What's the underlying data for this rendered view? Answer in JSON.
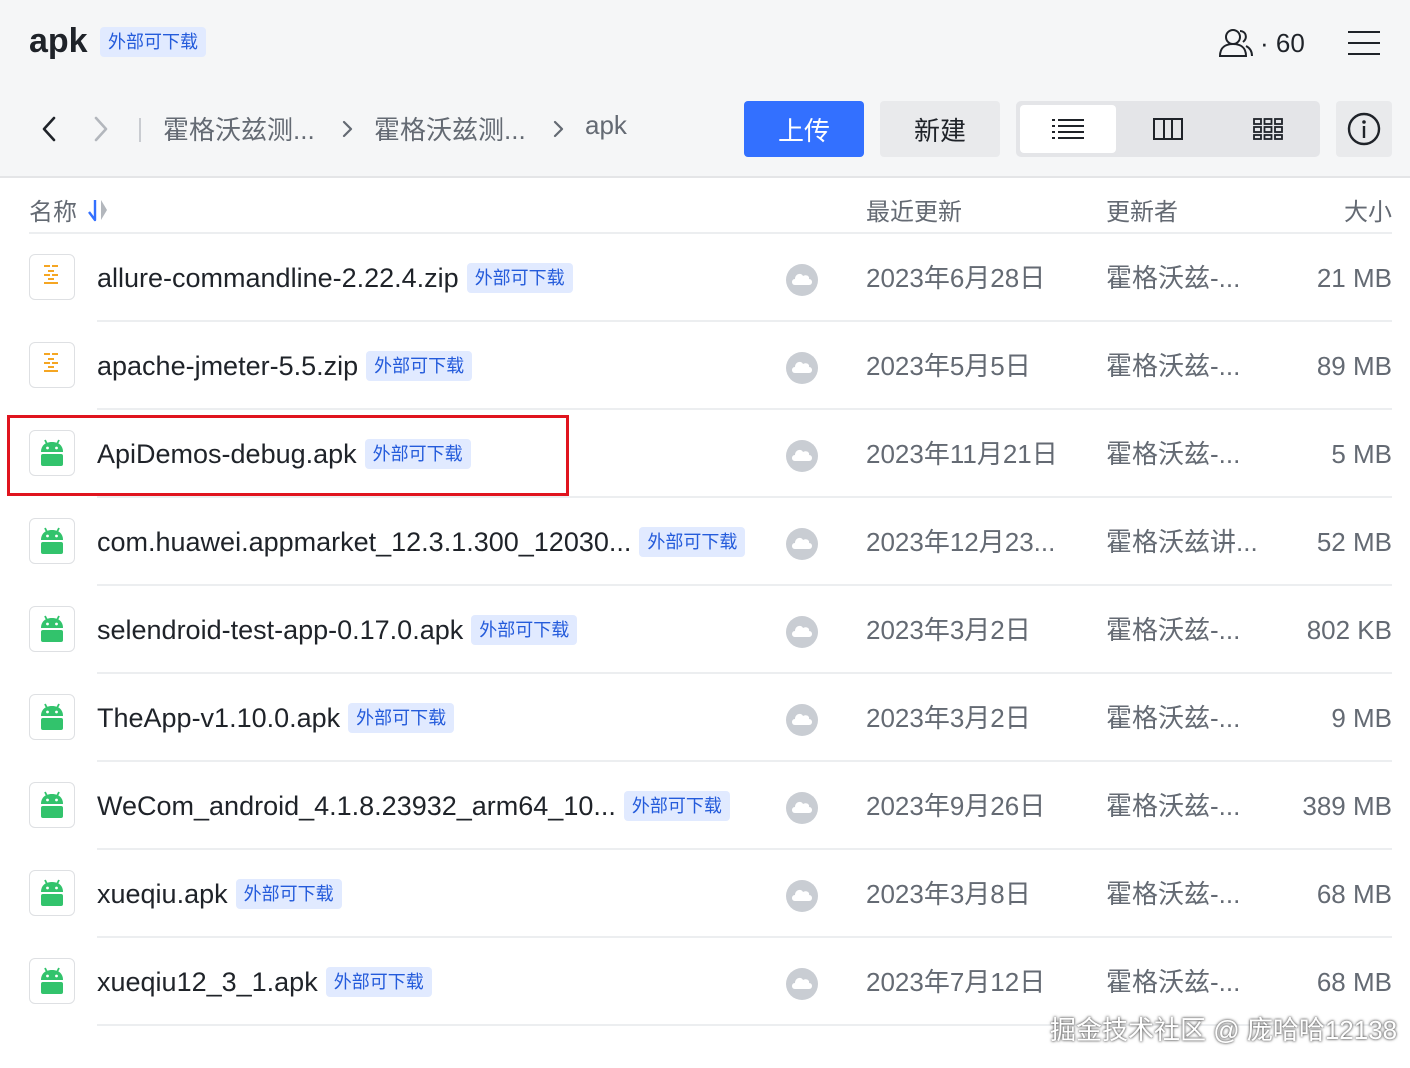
{
  "header": {
    "title": "apk",
    "title_badge": "外部可下载",
    "member_count": "· 60",
    "member_icon": "members-icon",
    "menu_icon": "hamburger-menu-icon"
  },
  "nav": {
    "back_icon": "chevron-left-icon",
    "forward_icon": "chevron-right-icon",
    "breadcrumbs": [
      "霍格沃兹测...",
      "霍格沃兹测...",
      "apk"
    ]
  },
  "toolbar": {
    "upload_label": "上传",
    "new_label": "新建",
    "views": [
      "list-view-icon",
      "column-view-icon",
      "grid-view-icon"
    ],
    "active_view": "list",
    "info_icon": "info-icon"
  },
  "columns": {
    "name": "名称",
    "updated": "最近更新",
    "updater": "更新者",
    "size": "大小",
    "sort_icon": "sort-icon"
  },
  "badge_text": "外部可下载",
  "files": [
    {
      "name": "allure-commandline-2.22.4.zip",
      "type": "zip",
      "badge": "外部可下载",
      "updated": "2023年6月28日",
      "updater": "霍格沃兹-...",
      "size": "21 MB"
    },
    {
      "name": "apache-jmeter-5.5.zip",
      "type": "zip",
      "badge": "外部可下载",
      "updated": "2023年5月5日",
      "updater": "霍格沃兹-...",
      "size": "89 MB"
    },
    {
      "name": "ApiDemos-debug.apk",
      "type": "apk",
      "badge": "外部可下载",
      "updated": "2023年11月21日",
      "updater": "霍格沃兹-...",
      "size": "5 MB"
    },
    {
      "name": "com.huawei.appmarket_12.3.1.300_12030...",
      "type": "apk",
      "badge": "外部可下载",
      "updated": "2023年12月23...",
      "updater": "霍格沃兹讲...",
      "size": "52 MB"
    },
    {
      "name": "selendroid-test-app-0.17.0.apk",
      "type": "apk",
      "badge": "外部可下载",
      "updated": "2023年3月2日",
      "updater": "霍格沃兹-...",
      "size": "802 KB"
    },
    {
      "name": "TheApp-v1.10.0.apk",
      "type": "apk",
      "badge": "外部可下载",
      "updated": "2023年3月2日",
      "updater": "霍格沃兹-...",
      "size": "9 MB"
    },
    {
      "name": "WeCom_android_4.1.8.23932_arm64_10...",
      "type": "apk",
      "badge": "外部可下载",
      "updated": "2023年9月26日",
      "updater": "霍格沃兹-...",
      "size": "389 MB"
    },
    {
      "name": "xueqiu.apk",
      "type": "apk",
      "badge": "外部可下载",
      "updated": "2023年3月8日",
      "updater": "霍格沃兹-...",
      "size": "68 MB"
    },
    {
      "name": "xueqiu12_3_1.apk",
      "type": "apk",
      "badge": "外部可下载",
      "updated": "2023年7月12日",
      "updater": "霍格沃兹-...",
      "size": "68 MB"
    }
  ],
  "highlighted_file": "ApiDemos-debug.apk",
  "watermark": "掘金技术社区 @ 庞哈哈12138",
  "colors": {
    "accent": "#3370ff",
    "badge_bg": "#e1eaff",
    "badge_text": "#245bdb",
    "android_green": "#32c36c",
    "zip_orange": "#f5a623",
    "highlight_red": "#e0141e"
  }
}
